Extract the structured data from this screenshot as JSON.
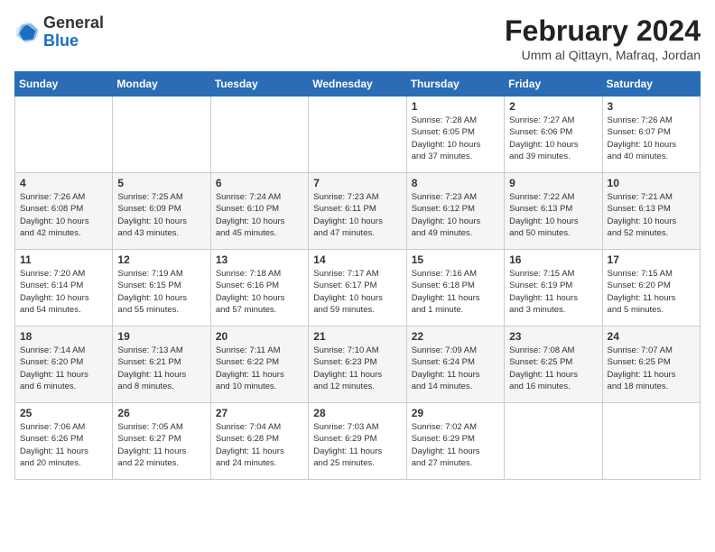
{
  "header": {
    "logo_general": "General",
    "logo_blue": "Blue",
    "month_year": "February 2024",
    "location": "Umm al Qittayn, Mafraq, Jordan"
  },
  "days_of_week": [
    "Sunday",
    "Monday",
    "Tuesday",
    "Wednesday",
    "Thursday",
    "Friday",
    "Saturday"
  ],
  "weeks": [
    [
      {
        "day": "",
        "info": ""
      },
      {
        "day": "",
        "info": ""
      },
      {
        "day": "",
        "info": ""
      },
      {
        "day": "",
        "info": ""
      },
      {
        "day": "1",
        "info": "Sunrise: 7:28 AM\nSunset: 6:05 PM\nDaylight: 10 hours\nand 37 minutes."
      },
      {
        "day": "2",
        "info": "Sunrise: 7:27 AM\nSunset: 6:06 PM\nDaylight: 10 hours\nand 39 minutes."
      },
      {
        "day": "3",
        "info": "Sunrise: 7:26 AM\nSunset: 6:07 PM\nDaylight: 10 hours\nand 40 minutes."
      }
    ],
    [
      {
        "day": "4",
        "info": "Sunrise: 7:26 AM\nSunset: 6:08 PM\nDaylight: 10 hours\nand 42 minutes."
      },
      {
        "day": "5",
        "info": "Sunrise: 7:25 AM\nSunset: 6:09 PM\nDaylight: 10 hours\nand 43 minutes."
      },
      {
        "day": "6",
        "info": "Sunrise: 7:24 AM\nSunset: 6:10 PM\nDaylight: 10 hours\nand 45 minutes."
      },
      {
        "day": "7",
        "info": "Sunrise: 7:23 AM\nSunset: 6:11 PM\nDaylight: 10 hours\nand 47 minutes."
      },
      {
        "day": "8",
        "info": "Sunrise: 7:23 AM\nSunset: 6:12 PM\nDaylight: 10 hours\nand 49 minutes."
      },
      {
        "day": "9",
        "info": "Sunrise: 7:22 AM\nSunset: 6:13 PM\nDaylight: 10 hours\nand 50 minutes."
      },
      {
        "day": "10",
        "info": "Sunrise: 7:21 AM\nSunset: 6:13 PM\nDaylight: 10 hours\nand 52 minutes."
      }
    ],
    [
      {
        "day": "11",
        "info": "Sunrise: 7:20 AM\nSunset: 6:14 PM\nDaylight: 10 hours\nand 54 minutes."
      },
      {
        "day": "12",
        "info": "Sunrise: 7:19 AM\nSunset: 6:15 PM\nDaylight: 10 hours\nand 55 minutes."
      },
      {
        "day": "13",
        "info": "Sunrise: 7:18 AM\nSunset: 6:16 PM\nDaylight: 10 hours\nand 57 minutes."
      },
      {
        "day": "14",
        "info": "Sunrise: 7:17 AM\nSunset: 6:17 PM\nDaylight: 10 hours\nand 59 minutes."
      },
      {
        "day": "15",
        "info": "Sunrise: 7:16 AM\nSunset: 6:18 PM\nDaylight: 11 hours\nand 1 minute."
      },
      {
        "day": "16",
        "info": "Sunrise: 7:15 AM\nSunset: 6:19 PM\nDaylight: 11 hours\nand 3 minutes."
      },
      {
        "day": "17",
        "info": "Sunrise: 7:15 AM\nSunset: 6:20 PM\nDaylight: 11 hours\nand 5 minutes."
      }
    ],
    [
      {
        "day": "18",
        "info": "Sunrise: 7:14 AM\nSunset: 6:20 PM\nDaylight: 11 hours\nand 6 minutes."
      },
      {
        "day": "19",
        "info": "Sunrise: 7:13 AM\nSunset: 6:21 PM\nDaylight: 11 hours\nand 8 minutes."
      },
      {
        "day": "20",
        "info": "Sunrise: 7:11 AM\nSunset: 6:22 PM\nDaylight: 11 hours\nand 10 minutes."
      },
      {
        "day": "21",
        "info": "Sunrise: 7:10 AM\nSunset: 6:23 PM\nDaylight: 11 hours\nand 12 minutes."
      },
      {
        "day": "22",
        "info": "Sunrise: 7:09 AM\nSunset: 6:24 PM\nDaylight: 11 hours\nand 14 minutes."
      },
      {
        "day": "23",
        "info": "Sunrise: 7:08 AM\nSunset: 6:25 PM\nDaylight: 11 hours\nand 16 minutes."
      },
      {
        "day": "24",
        "info": "Sunrise: 7:07 AM\nSunset: 6:25 PM\nDaylight: 11 hours\nand 18 minutes."
      }
    ],
    [
      {
        "day": "25",
        "info": "Sunrise: 7:06 AM\nSunset: 6:26 PM\nDaylight: 11 hours\nand 20 minutes."
      },
      {
        "day": "26",
        "info": "Sunrise: 7:05 AM\nSunset: 6:27 PM\nDaylight: 11 hours\nand 22 minutes."
      },
      {
        "day": "27",
        "info": "Sunrise: 7:04 AM\nSunset: 6:28 PM\nDaylight: 11 hours\nand 24 minutes."
      },
      {
        "day": "28",
        "info": "Sunrise: 7:03 AM\nSunset: 6:29 PM\nDaylight: 11 hours\nand 25 minutes."
      },
      {
        "day": "29",
        "info": "Sunrise: 7:02 AM\nSunset: 6:29 PM\nDaylight: 11 hours\nand 27 minutes."
      },
      {
        "day": "",
        "info": ""
      },
      {
        "day": "",
        "info": ""
      }
    ]
  ]
}
